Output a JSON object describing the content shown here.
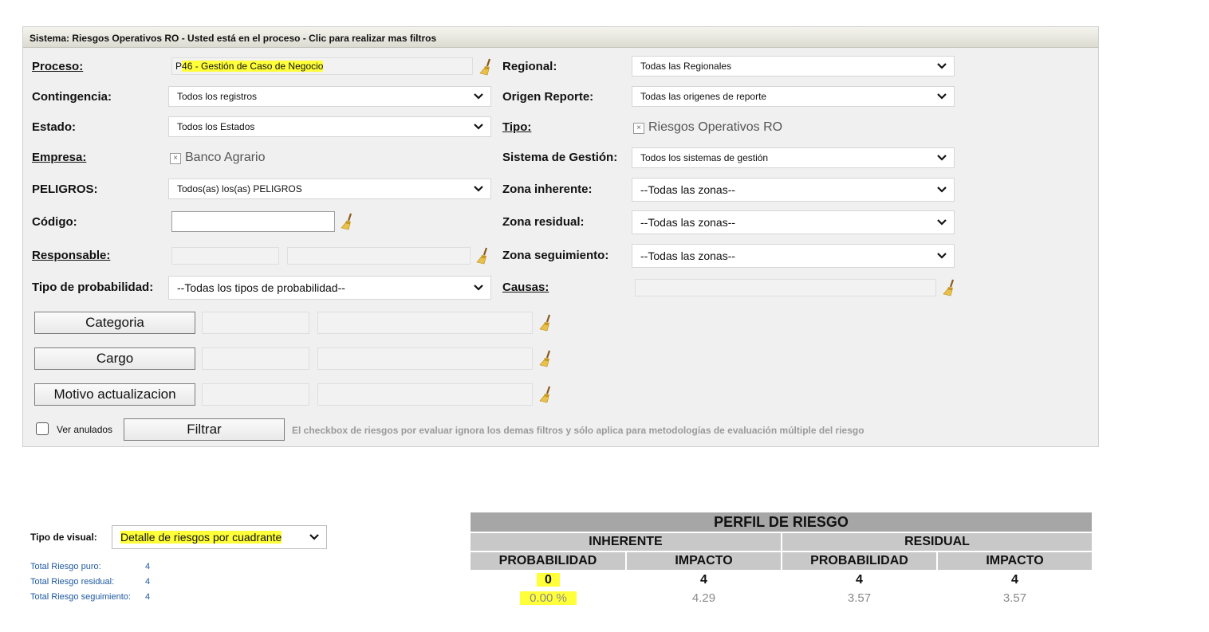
{
  "header": {
    "title": "Sistema: Riesgos Operativos RO - Usted está en el proceso - Clic para realizar mas filtros"
  },
  "filters": {
    "proceso": {
      "label": "Proceso:",
      "value_prefix": "P",
      "value_highlight": "46 - Gestión de Caso de Negocio"
    },
    "regional": {
      "label": "Regional:",
      "value": "Todas las Regionales"
    },
    "contingencia": {
      "label": "Contingencia:",
      "value": "Todos los registros"
    },
    "origen": {
      "label": "Origen Reporte:",
      "value": "Todas las origenes de reporte"
    },
    "estado": {
      "label": "Estado:",
      "value": "Todos los Estados"
    },
    "tipo": {
      "label": "Tipo:",
      "value": "Riesgos Operativos RO"
    },
    "empresa": {
      "label": "Empresa:",
      "value": "Banco Agrario"
    },
    "sistema": {
      "label": "Sistema de Gestión:",
      "value": "Todos los sistemas de gestión"
    },
    "peligros": {
      "label": "PELIGROS:",
      "value": "Todos(as) los(as) PELIGROS"
    },
    "zona_inherente": {
      "label": "Zona inherente:",
      "value": "--Todas las zonas--"
    },
    "codigo": {
      "label": "Código:",
      "value": ""
    },
    "zona_residual": {
      "label": "Zona residual:",
      "value": "--Todas las zonas--"
    },
    "responsable": {
      "label": "Responsable:"
    },
    "zona_seguimiento": {
      "label": "Zona seguimiento:",
      "value": "--Todas las zonas--"
    },
    "tipo_probabilidad": {
      "label": "Tipo de probabilidad:",
      "value": "--Todas los tipos de probabilidad--"
    },
    "causas": {
      "label": "Causas:"
    },
    "categoria_button": "Categoria",
    "cargo_button": "Cargo",
    "motivo_button": "Motivo actualizacion",
    "ver_anulados": "Ver anulados",
    "filtrar_button": "Filtrar",
    "note": "El checkbox de riesgos por evaluar ignora los demas filtros y sólo aplica para metodologías de evaluación múltiple del riesgo"
  },
  "visual": {
    "label": "Tipo de visual:",
    "value": "Detalle de riesgos por cuadrante"
  },
  "totals": [
    {
      "label": "Total Riesgo puro:",
      "value": "4"
    },
    {
      "label": "Total Riesgo residual:",
      "value": "4"
    },
    {
      "label": "Total Riesgo seguimiento:",
      "value": "4"
    }
  ],
  "perfil": {
    "title": "PERFIL DE RIESGO",
    "inherente": "INHERENTE",
    "residual": "RESIDUAL",
    "probabilidad": "PROBABILIDAD",
    "impacto": "IMPACTO",
    "values": [
      "0",
      "4",
      "4",
      "4"
    ],
    "averages": [
      "0.00 %",
      "4.29",
      "3.57",
      "3.57"
    ]
  },
  "colors": {
    "highlight": "#ffff3a",
    "panel_bg": "#f0f0f0",
    "link": "#1f5aa0",
    "table_header": "#c8c8c8",
    "table_title": "#a6a6a6"
  }
}
